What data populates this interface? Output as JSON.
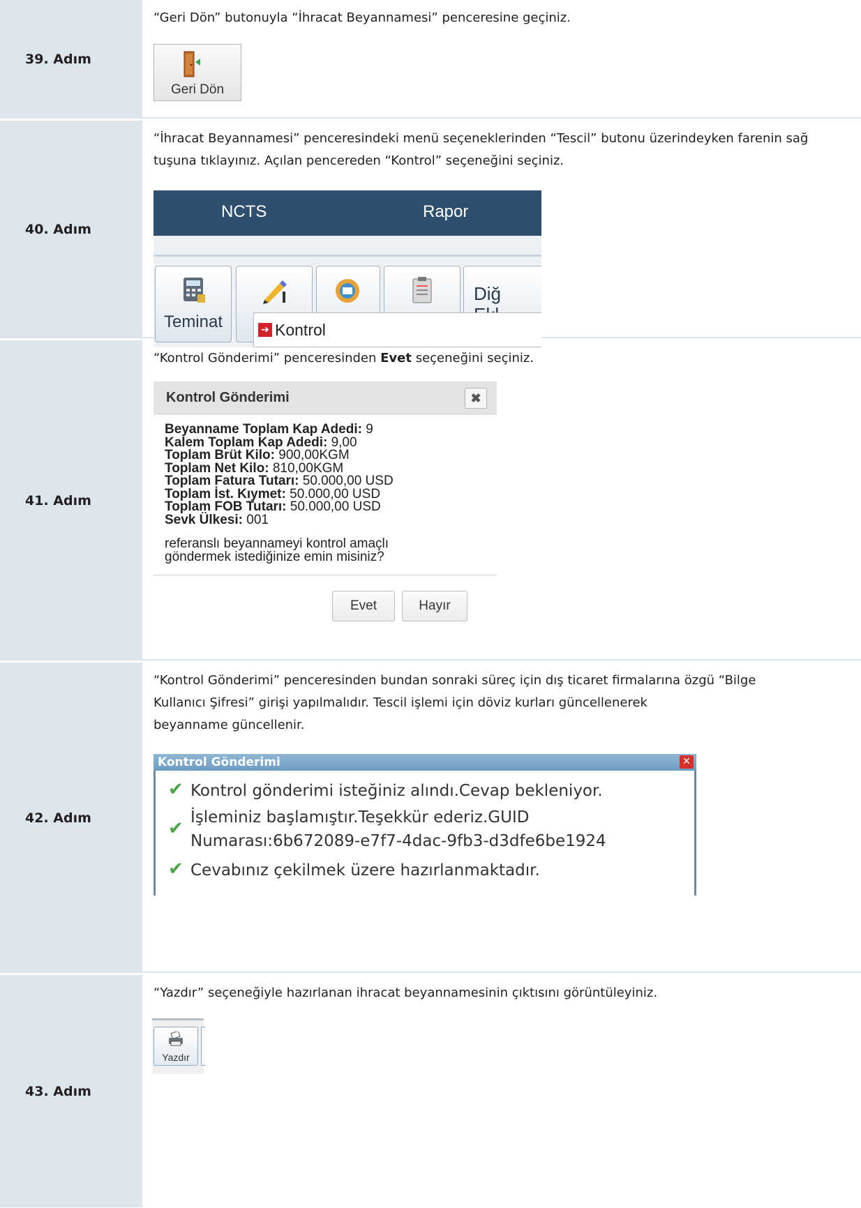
{
  "steps": [
    {
      "label": "39. Adım",
      "instruction": "“Geri Dön” butonuyla “İhracat Beyannamesi” penceresine geçiniz.",
      "button_label": "Geri Dön"
    },
    {
      "label": "40. Adım",
      "instruction": "“İhracat Beyannamesi” penceresindeki menü seçeneklerinden “Tescil” butonu üzerindeyken farenin sağ tuşuna tıklayınız. Açılan pencereden “Kontrol” seçeneğini seçiniz.",
      "menu": [
        "NCTS",
        "Rapor"
      ],
      "tools": [
        "Teminat",
        "",
        "",
        "",
        "Diğ Ekl"
      ],
      "context_item": "Kontrol"
    },
    {
      "label": "41. Adım",
      "instruction_before": "“Kontrol Gönderimi” penceresinden ",
      "instruction_bold": "Evet",
      "instruction_after": " seçeneğini seçiniz.",
      "dialog": {
        "title": "Kontrol Gönderimi",
        "close": "✖",
        "fields": [
          {
            "key": "Beyanname Toplam Kap Adedi:",
            "value": " 9"
          },
          {
            "key": "Kalem Toplam Kap Adedi:",
            "value": " 9,00"
          },
          {
            "key": "Toplam Brüt Kilo:",
            "value": " 900,00KGM"
          },
          {
            "key": "Toplam Net Kilo:",
            "value": " 810,00KGM"
          },
          {
            "key": "Toplam Fatura Tutarı:",
            "value": " 50.000,00 USD"
          },
          {
            "key": "Toplam İst. Kıymet:",
            "value": " 50.000,00 USD"
          },
          {
            "key": "Toplam FOB Tutarı:",
            "value": " 50.000,00 USD"
          },
          {
            "key": "Sevk Ülkesi:",
            "value": " 001"
          }
        ],
        "question_line1": "referanslı beyannameyi kontrol amaçlı",
        "question_line2": "göndermek istediğinize emin misiniz?",
        "yes": "Evet",
        "no": "Hayır"
      }
    },
    {
      "label": "42. Adım",
      "instruction_line1": "“Kontrol Gönderimi” penceresinden bundan sonraki süreç için dış ticaret firmalarına özgü “Bilge",
      "instruction_line2": "Kullanıcı Şifresi” girişi yapılmalıdır. Tescil işlemi için döviz kurları güncellenerek",
      "instruction_line3": "beyanname güncellenir.",
      "dialog": {
        "title": "Kontrol Gönderimi",
        "close": "✕",
        "messages": [
          "Kontrol gönderimi isteğiniz alındı.Cevap bekleniyor.",
          "İşleminiz başlamıştır.Teşekkür ederiz.GUID",
          "Numarası:6b672089-e7f7-4dac-9fb3-d3dfe6be1924",
          "Cevabınız çekilmek üzere hazırlanmaktadır."
        ]
      }
    },
    {
      "label": "43. Adım",
      "instruction": "“Yazdır” seçeneğiyle hazırlanan ihracat beyannamesinin çıktısını görüntüleyiniz.",
      "button_label": "Yazdır"
    }
  ],
  "colors": {
    "label_bg": "#dce5ec",
    "menu_bar": "#2f4f6e",
    "dialog42_header": "#7aa6c9",
    "check_green": "#4ca44a"
  }
}
